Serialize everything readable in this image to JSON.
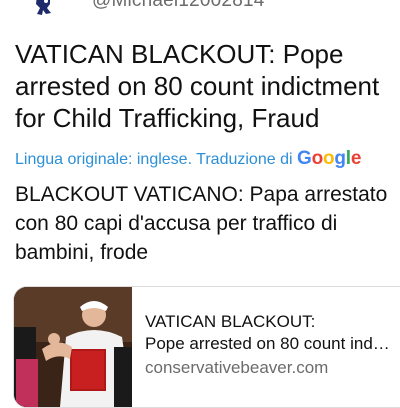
{
  "tweet": {
    "handle": "@Michael12002814",
    "text": "VATICAN BLACKOUT: Pope arrested on 80 count indictment for Child Trafficking, Fraud",
    "translation_note": "Lingua originale: inglese. Traduzione di",
    "translation_provider": {
      "letters": [
        "G",
        "o",
        "o",
        "g",
        "l",
        "e"
      ]
    },
    "translated_text": "BLACKOUT VATICANO: Papa arrestato con 80 capi d'accusa per traffico di bambini, frode"
  },
  "link_card": {
    "title": "VATICAN BLACKOUT:",
    "subtitle": "Pope arrested on 80 count ind…",
    "domain": "conservativebeaver.com"
  },
  "icons": {
    "avatar": "avatar-icon",
    "thumbnail": "article-thumbnail-image"
  },
  "colors": {
    "translation_link": "#2d8fd6",
    "handle": "#6b6b6b",
    "domain": "#6b6b6b"
  }
}
